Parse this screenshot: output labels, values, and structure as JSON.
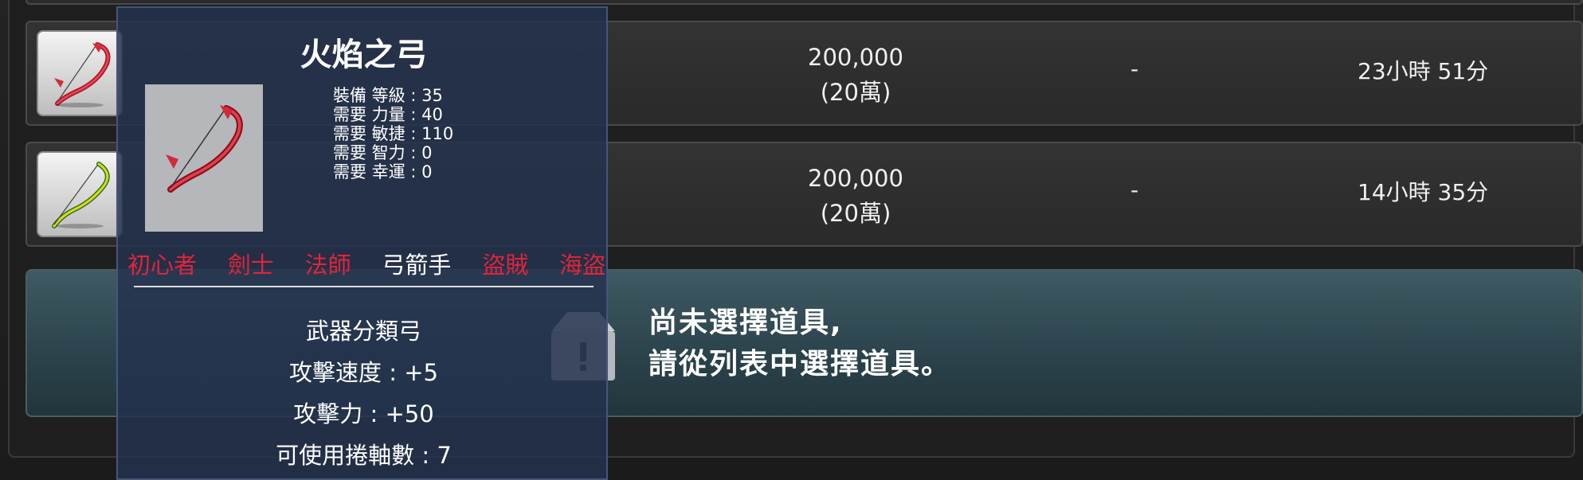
{
  "listings": [
    {
      "icon": "flame-bow-icon",
      "price": "200,000",
      "price_short": "(20萬)",
      "extra": "-",
      "time_left": "23小時 51分"
    },
    {
      "icon": "green-bow-icon",
      "price": "200,000",
      "price_short": "(20萬)",
      "extra": "-",
      "time_left": "14小時 35分"
    }
  ],
  "empty_state": {
    "icon": "box-alert-icon",
    "line1": "尚未選擇道具,",
    "line2": "請從列表中選擇道具。"
  },
  "tooltip": {
    "item_name": "火焰之弓",
    "stats": [
      {
        "label": "裝備 等級",
        "value": "35"
      },
      {
        "label": "需要 力量",
        "value": "40"
      },
      {
        "label": "需要 敏捷",
        "value": "110"
      },
      {
        "label": "需要 智力",
        "value": "0"
      },
      {
        "label": "需要 幸運",
        "value": "0"
      }
    ],
    "jobs": [
      {
        "name": "初心者",
        "allowed": false
      },
      {
        "name": "劍士",
        "allowed": false
      },
      {
        "name": "法師",
        "allowed": false
      },
      {
        "name": "弓箭手",
        "allowed": true
      },
      {
        "name": "盜賊",
        "allowed": false
      },
      {
        "name": "海盜",
        "allowed": false
      }
    ],
    "weapon_type": "武器分類弓",
    "attack_speed": "攻擊速度 : +5",
    "attack_power": "攻擊力 : +50",
    "scrolls": "可使用捲軸數 : 7",
    "colors": {
      "allowed": "#ffffff",
      "not_allowed": "#e2243a"
    }
  }
}
